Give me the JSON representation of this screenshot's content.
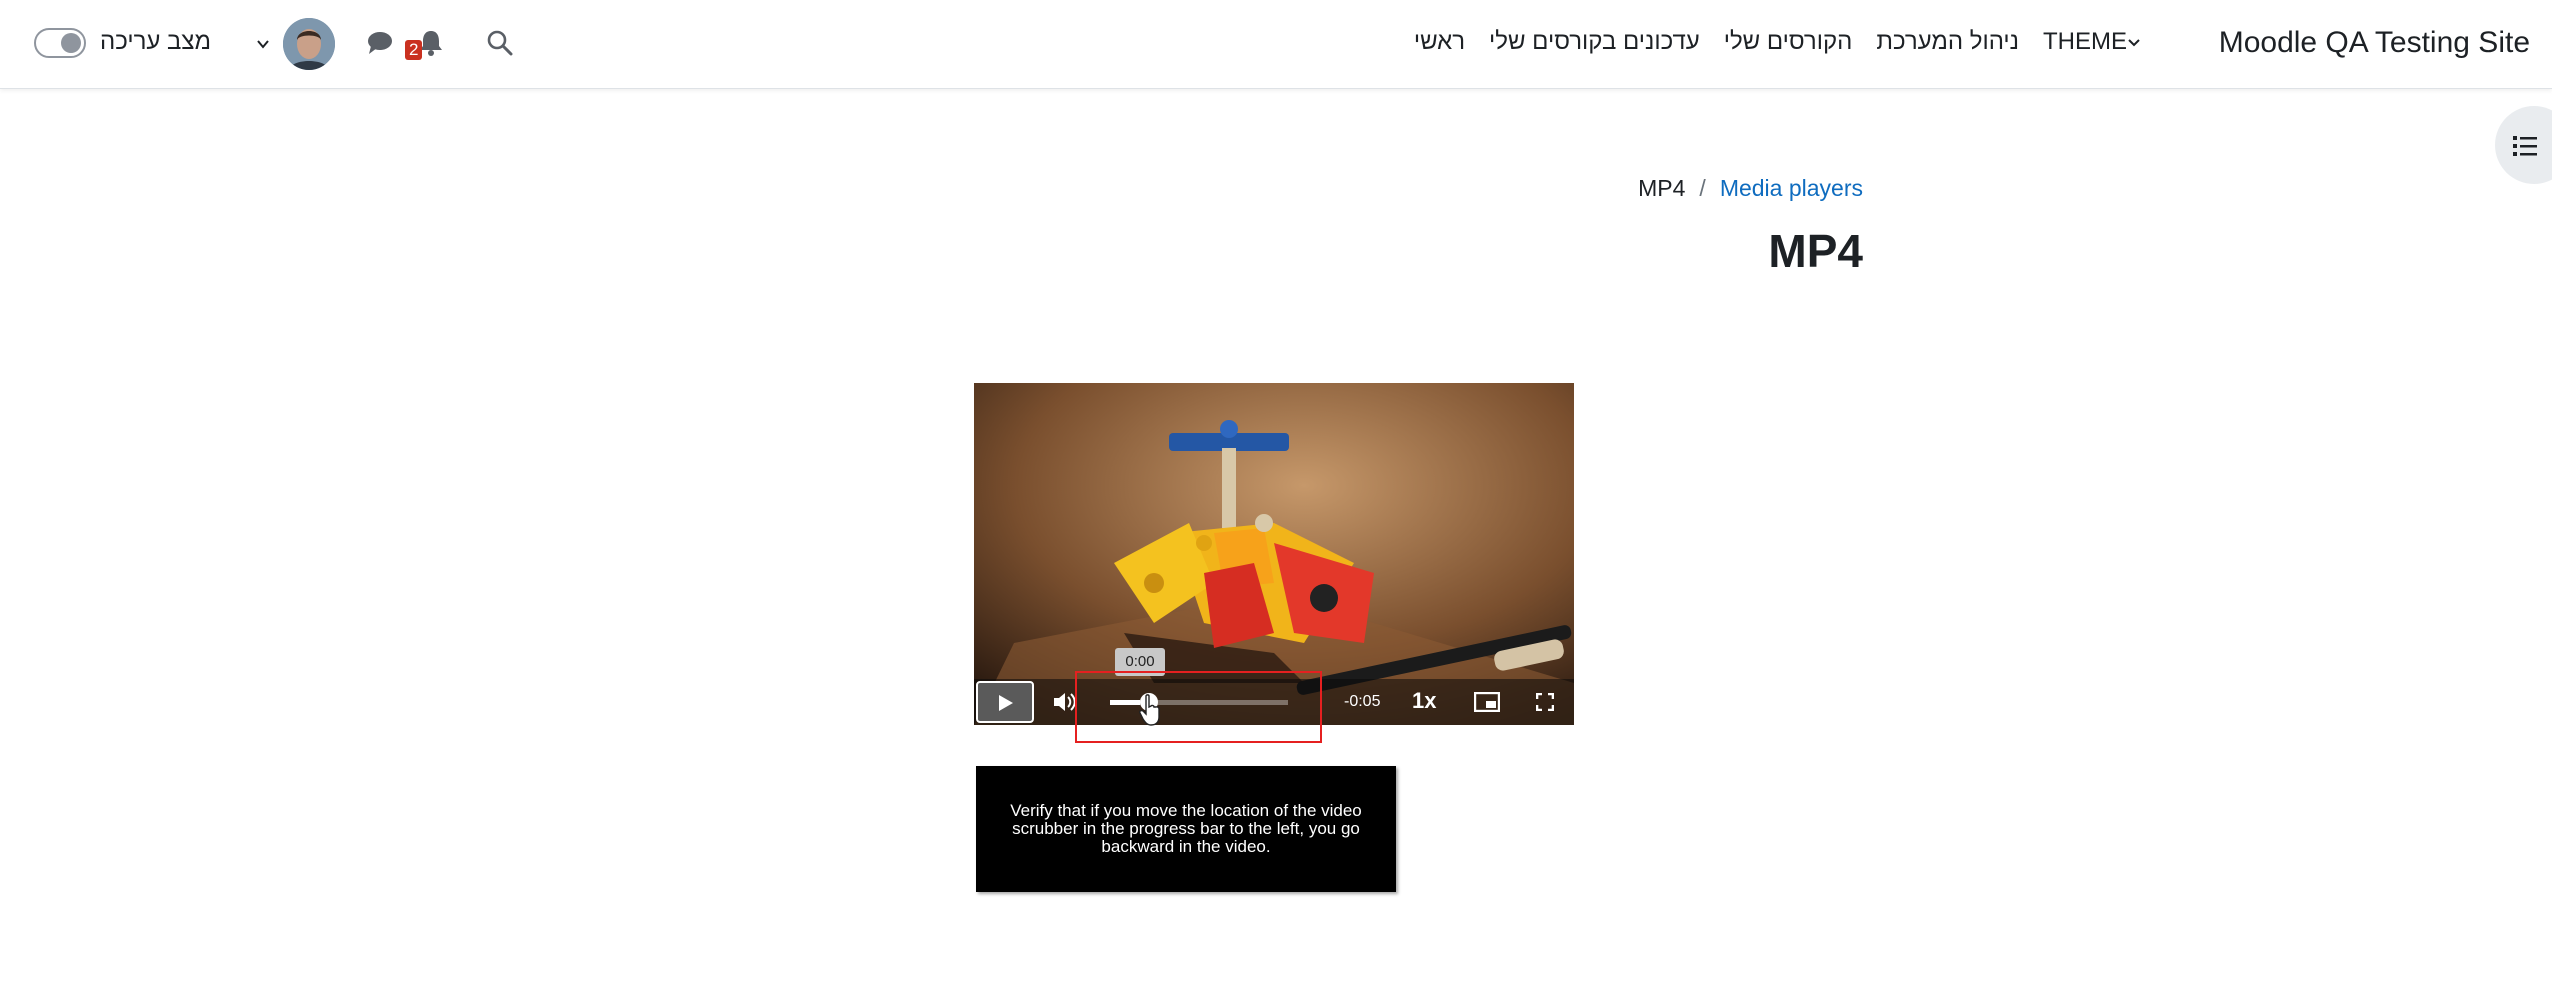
{
  "navbar": {
    "site_name": "Moodle QA Testing Site",
    "nav_items": [
      {
        "label": "ראשי"
      },
      {
        "label": "עדכונים בקורסים שלי"
      },
      {
        "label": "הקורסים שלי"
      },
      {
        "label": "ניהול המערכת"
      },
      {
        "label": "THEME"
      }
    ],
    "notification_count": "2",
    "edit_mode_label": "מצב עריכה",
    "icons": [
      "search-icon",
      "bell-icon",
      "chat-icon",
      "chevron-down-icon"
    ]
  },
  "breadcrumb": {
    "items": [
      "MP4",
      "Media players"
    ],
    "separator": "/"
  },
  "page": {
    "title": "MP4"
  },
  "player": {
    "remaining_time": "-0:05",
    "speed": "1x",
    "tooltip_time": "0:00",
    "progress_fraction": 0.17,
    "icons": [
      "play-icon",
      "volume-icon",
      "picture-in-picture-icon",
      "fullscreen-icon"
    ]
  },
  "instruction": {
    "text": "Verify that if you move the location of the video scrubber in the progress bar to the left, you go backward in the video."
  },
  "colors": {
    "link": "#0f6cbf",
    "highlight": "#e52020",
    "badge": "#ca3120"
  }
}
